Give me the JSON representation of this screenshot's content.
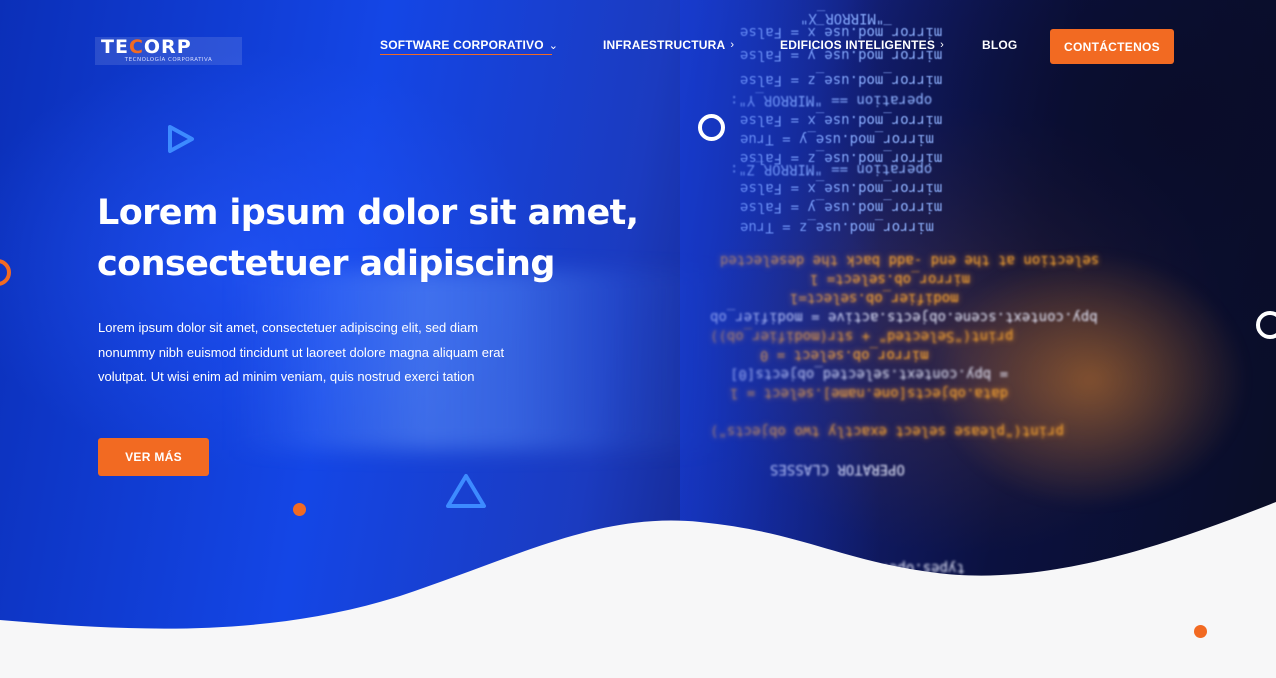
{
  "brand": {
    "logo_main_a": "TE",
    "logo_main_b": "C",
    "logo_main_c": "ORP",
    "logo_sub": "TECNOLOGÍA CORPORATIVA"
  },
  "nav": {
    "items": [
      {
        "label": "SOFTWARE CORPORATIVO",
        "chevron": "⌄",
        "active": true
      },
      {
        "label": "INFRAESTRUCTURA",
        "chevron": "›"
      },
      {
        "label": "EDIFICIOS INTELIGENTES",
        "chevron": "›"
      },
      {
        "label": "BLOG",
        "chevron": ""
      }
    ],
    "cta_label": "CONTÁCTENOS"
  },
  "hero": {
    "title_line1": "Lorem ipsum dolor sit amet,",
    "title_line2": "consectetuer adipiscing",
    "paragraph_line1": "Lorem ipsum dolor sit amet, consectetuer adipiscing elit, sed diam",
    "paragraph_line2": "nonummy nibh euismod tincidunt ut laoreet dolore magna aliquam erat",
    "paragraph_line3": "volutpat. Ut wisi enim ad minim veniam, quis nostrud exerci tation",
    "button_label": "VER MÁS"
  },
  "code_lines": [
    "\"MIRROR_X\"",
    "mirror_mod.use_x = False",
    "mirror_mod.use_y = False",
    "mirror_mod.use_z = False",
    "operation == \"MIRROR_Y\":",
    "mirror_mod.use_x = False",
    "mirror_mod.use_y = True",
    "mirror_mod.use_z = False",
    "operation == \"MIRROR_Z\":",
    "mirror_mod.use_x = False",
    "mirror_mod.use_y = False",
    "mirror_mod.use_z = True",
    "selection at the end -add back the deselected",
    "mirror_ob.select= 1",
    "modifier_ob.select=1",
    "bpy.context.scene.objects.active = modifier_ob",
    "print(\"Selected\" + str(modifier_ob))",
    "mirror_ob.select = 0",
    "= bpy.context.selected_objects[0]",
    "data.objects[one.name].select = 1",
    "print(\"please select exactly two objects\")",
    "OPERATOR CLASSES",
    "types.Operator):"
  ],
  "colors": {
    "accent": "#f26a22",
    "hero_blue": "#1446e6",
    "page_bg": "#f7f7f8"
  },
  "icons": {
    "play": "play-triangle-icon",
    "triangle": "outline-triangle-icon",
    "ring": "ring-icon",
    "dot": "dot-icon"
  }
}
